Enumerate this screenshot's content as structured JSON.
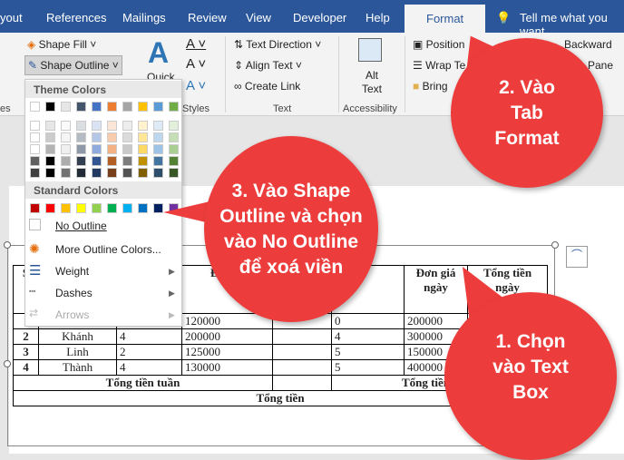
{
  "tabs": [
    "yout",
    "References",
    "Mailings",
    "Review",
    "View",
    "Developer",
    "Help",
    "Format"
  ],
  "tell_me": "Tell me what you want",
  "ribbon": {
    "shape_fill": "Shape Fill",
    "shape_outline": "Shape Outline",
    "quick": "Quick",
    "text_direction": "Text Direction",
    "align_text": "Align Text",
    "create_link": "Create Link",
    "alt_text": "Alt Text",
    "position": "Position",
    "wrap_text": "Wrap Te",
    "bring": "Bring",
    "backward": "Backward",
    "pane": "Pane",
    "groups": {
      "styles_left": "es",
      "wordart": "Styles",
      "text": "Text",
      "accessibility": "Accessibility"
    }
  },
  "menu": {
    "theme_colors": "Theme Colors",
    "standard_colors": "Standard Colors",
    "no_outline": "No Outline",
    "more_colors": "More Outline Colors...",
    "weight": "Weight",
    "dashes": "Dashes",
    "arrows": "Arrows",
    "theme": [
      "#ffffff",
      "#000000",
      "#e7e6e6",
      "#44546a",
      "#4472c4",
      "#ed7d31",
      "#a5a5a5",
      "#ffc000",
      "#5b9bd5",
      "#70ad47"
    ],
    "standard": [
      "#c00000",
      "#ff0000",
      "#ffc000",
      "#ffff00",
      "#92d050",
      "#00b050",
      "#00b0f0",
      "#0070c0",
      "#002060",
      "#7030a0"
    ]
  },
  "table": {
    "header": [
      "S",
      "",
      "",
      "Đơn gi",
      "",
      "",
      "Đơn giá ngày",
      "Tổng tiền ngày"
    ],
    "rows": [
      [
        "",
        "",
        "",
        "120000",
        "",
        "0",
        "200000",
        ""
      ],
      [
        "2",
        "Khánh",
        "4",
        "200000",
        "",
        "4",
        "300000",
        ""
      ],
      [
        "3",
        "Linh",
        "2",
        "125000",
        "",
        "5",
        "150000",
        ""
      ],
      [
        "4",
        "Thành",
        "4",
        "130000",
        "",
        "5",
        "400000",
        ""
      ]
    ],
    "week_total": "Tổng tiền tuần",
    "day_total": "Tổng tiền ngày",
    "total": "Tổng tiền"
  },
  "callouts": {
    "step1": "1. Chọn vào Text Box",
    "step2": "2. Vào Tab Format",
    "step3": "3. Vào Shape Outline và chọn vào No Outline để xoá viền"
  },
  "colors": {
    "ribbon_blue": "#2b579a",
    "callout_red": "#ec3d3c"
  }
}
